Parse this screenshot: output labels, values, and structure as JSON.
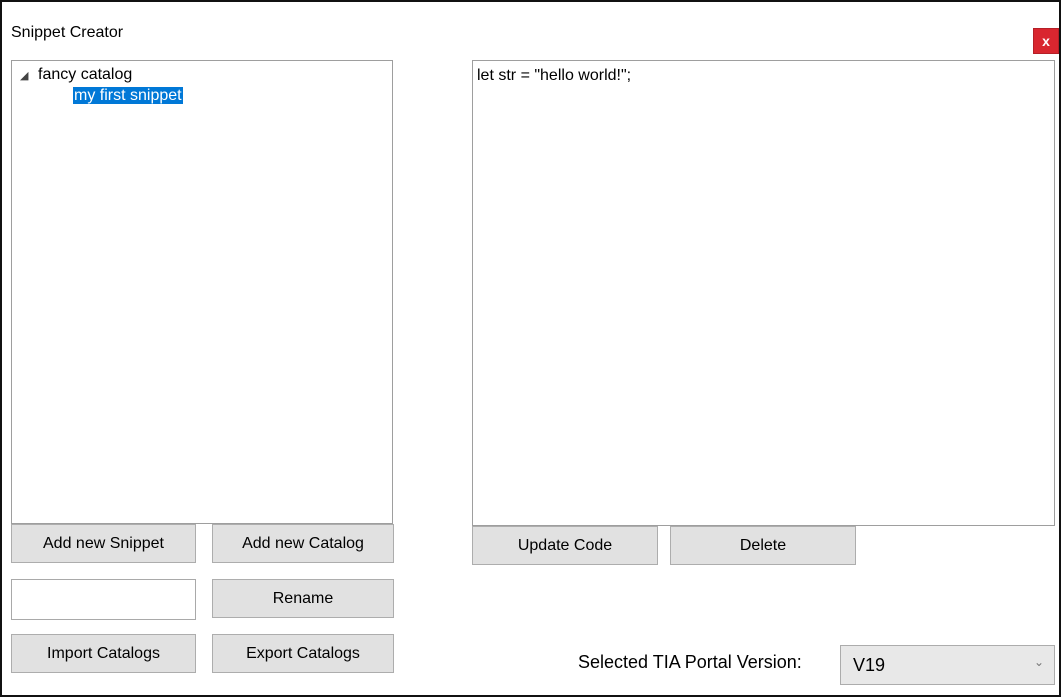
{
  "window": {
    "title": "Snippet Creator",
    "close_label": "x"
  },
  "tree": {
    "catalog": {
      "arrow": "◢",
      "label": "fancy catalog"
    },
    "snippet": {
      "label": "my first snippet",
      "selected": true
    }
  },
  "code_editor": {
    "value": "let str = \"hello world!\";"
  },
  "buttons": {
    "add_snippet": "Add new Snippet",
    "add_catalog": "Add new Catalog",
    "rename": "Rename",
    "import_catalogs": "Import Catalogs",
    "export_catalogs": "Export Catalogs",
    "update_code": "Update Code",
    "delete": "Delete"
  },
  "rename_input": {
    "value": ""
  },
  "version": {
    "label": "Selected TIA Portal Version:",
    "selected": "V19",
    "chevron": "⌄"
  },
  "colors": {
    "selection": "#0078d7",
    "close": "#d9262f",
    "button_face": "#e1e1e1"
  }
}
